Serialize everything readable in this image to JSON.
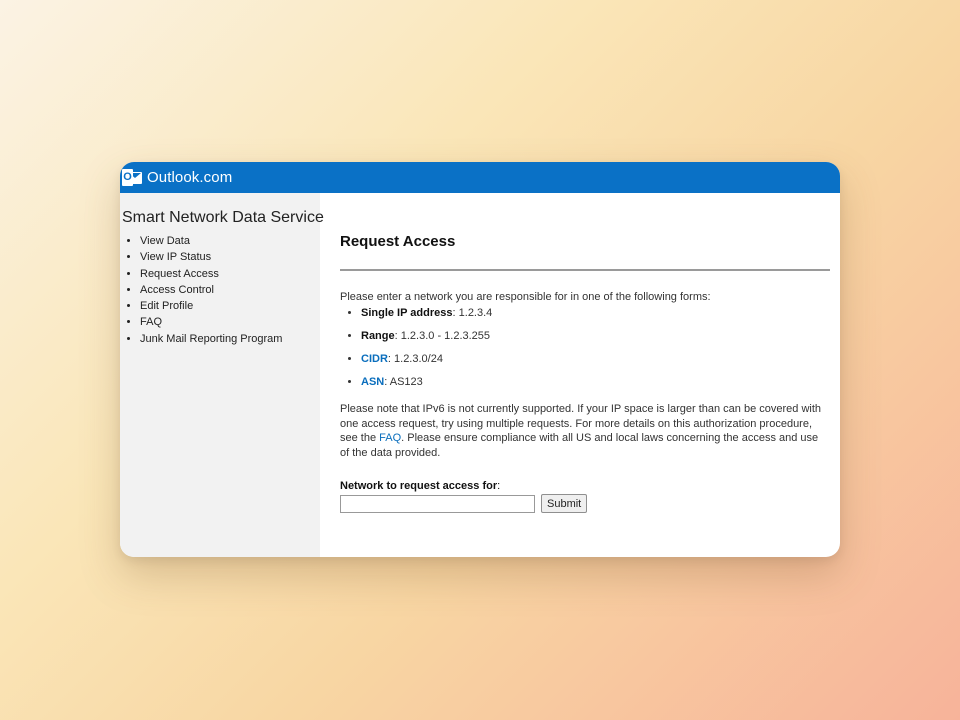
{
  "header": {
    "logo_letter": "O",
    "brand": "Outlook.com",
    "color": "#0a71c6"
  },
  "sidebar": {
    "title": "Smart Network Data Service",
    "items": [
      {
        "label": "View Data"
      },
      {
        "label": "View IP Status"
      },
      {
        "label": "Request Access"
      },
      {
        "label": "Access Control"
      },
      {
        "label": "Edit Profile"
      },
      {
        "label": "FAQ"
      },
      {
        "label": "Junk Mail Reporting Program"
      }
    ]
  },
  "main": {
    "title": "Request Access",
    "intro": "Please enter a network you are responsible for in one of the following forms:",
    "forms": [
      {
        "name": "Single IP address",
        "value": "1.2.3.4"
      },
      {
        "name": "Range",
        "value": "1.2.3.0 - 1.2.3.255"
      },
      {
        "name": "CIDR",
        "value": "1.2.3.0/24"
      },
      {
        "name": "ASN",
        "value": "AS123"
      }
    ],
    "note_part1": "Please note that IPv6 is not currently supported.  If your IP space is larger than can be covered with one access request, try using multiple requests.  For more details on this authorization procedure, see the ",
    "note_link": "FAQ",
    "note_part2": ".  Please ensure compliance with all US and local laws concerning the access and use of the data provided.",
    "input_label": "Network to request access for",
    "input_label_suffix": ":",
    "input_value": "",
    "input_placeholder": "",
    "submit_label": "Submit"
  }
}
